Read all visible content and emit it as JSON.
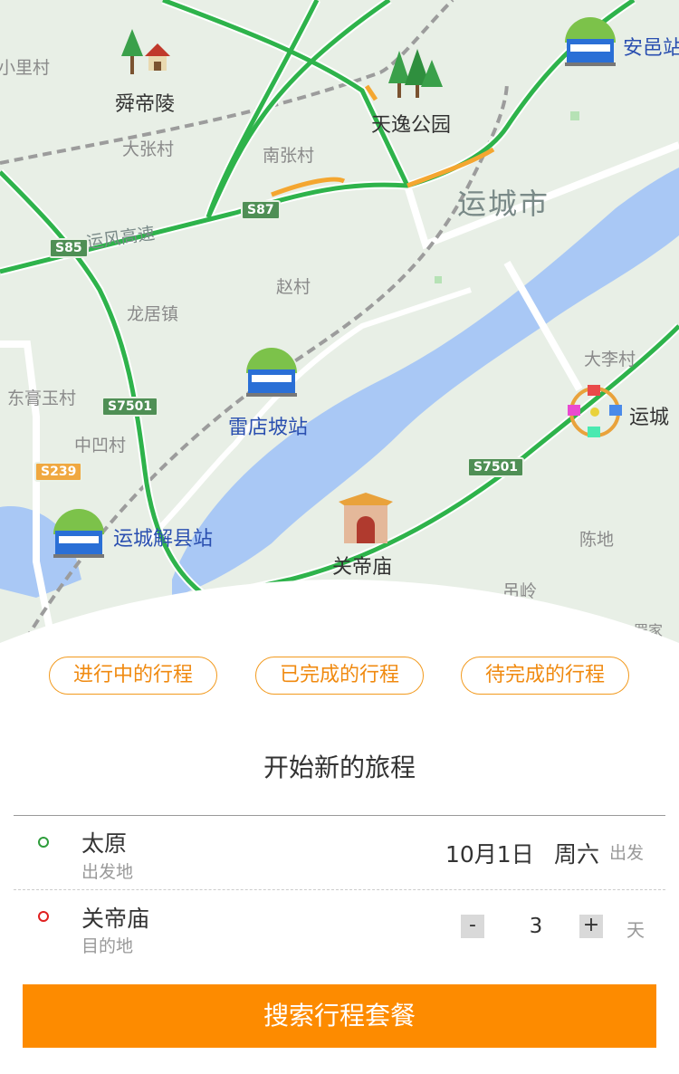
{
  "map": {
    "places": [
      {
        "id": "xiaolicun",
        "label": "小里村"
      },
      {
        "id": "dazhangcun",
        "label": "大张村"
      },
      {
        "id": "nanzhangcun",
        "label": "南张村"
      },
      {
        "id": "zhaocun",
        "label": "赵村"
      },
      {
        "id": "longjuzhen",
        "label": "龙居镇"
      },
      {
        "id": "donggaoyucun",
        "label": "东膏玉村"
      },
      {
        "id": "zhongaocun",
        "label": "中凹村"
      },
      {
        "id": "dalicun",
        "label": "大李村"
      },
      {
        "id": "chendi",
        "label": "陈地"
      },
      {
        "id": "diaoling",
        "label": "吊岭"
      },
      {
        "id": "yanjia",
        "label": "罡家"
      }
    ],
    "city_label": "运城市",
    "road_label": "运风高速",
    "pois": {
      "shundiling": "舜帝陵",
      "tianyi_park": "天逸公园",
      "anyi_station": "安邑站",
      "leidianpo_station": "雷店坡站",
      "yuncheng_xiexian_station": "运城解县站",
      "guandimiao": "关帝庙",
      "yuncheng_other": "运城"
    },
    "shields": {
      "s87": "S87",
      "s85": "S85",
      "s7501_a": "S7501",
      "s7501_b": "S7501",
      "s239": "S239"
    },
    "colors": {
      "land": "#e8efe6",
      "water": "#a9c8f5",
      "highway": "#2eb34b",
      "highway_edge": "#ffffff",
      "congestion": "#f4a630"
    }
  },
  "tabs": [
    "进行中的行程",
    "已完成的行程",
    "待完成的行程"
  ],
  "accent_color": "#fd8b00",
  "section_title": "开始新的旅程",
  "origin": {
    "city": "太原",
    "label": "出发地"
  },
  "destination": {
    "city": "关帝庙",
    "label": "目的地"
  },
  "date": {
    "value": "10月1日",
    "weekday": "周六",
    "suffix": "出发"
  },
  "duration": {
    "minus": "-",
    "value": "3",
    "plus": "+",
    "unit": "天"
  },
  "search_button": "搜索行程套餐"
}
